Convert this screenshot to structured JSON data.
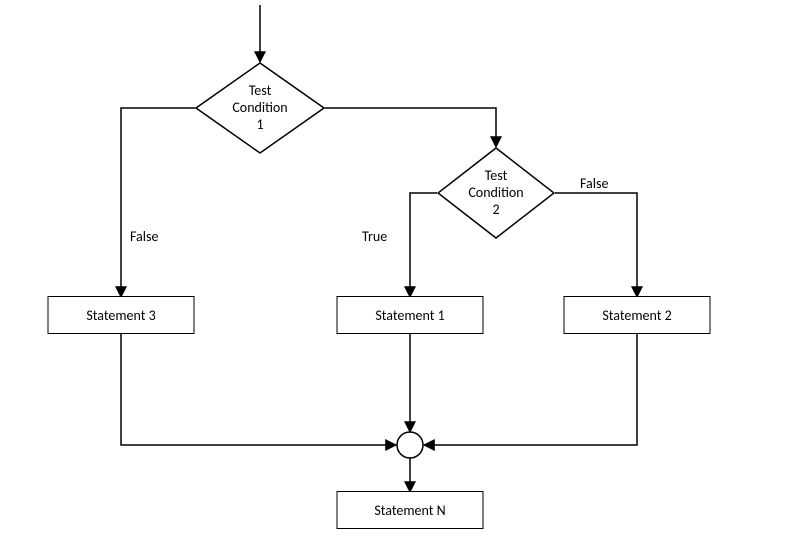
{
  "condition1": {
    "line1": "Test",
    "line2": "Condition",
    "line3": "1"
  },
  "condition2": {
    "line1": "Test",
    "line2": "Condition",
    "line3": "2"
  },
  "statement1": "Statement 1",
  "statement2": "Statement 2",
  "statement3": "Statement 3",
  "statementN": "Statement N",
  "labels": {
    "falseLeft": "False",
    "trueMid": "True",
    "falseRight": "False"
  }
}
